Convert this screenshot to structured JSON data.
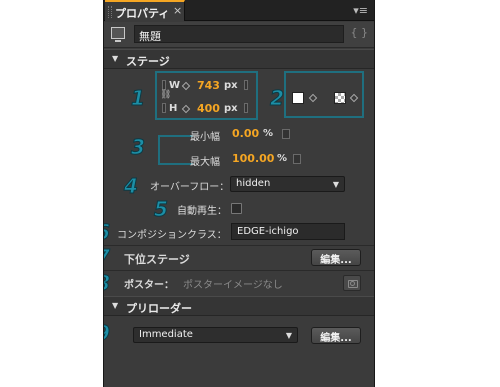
{
  "tab": {
    "title": "プロパティ",
    "close": "×",
    "menu_icon": "panel-menu-icon"
  },
  "document": {
    "name": "無題",
    "code_icon": "{ }"
  },
  "sections": {
    "stage": "ステージ",
    "preloader": "プリローダー"
  },
  "stage": {
    "w_label": "W",
    "h_label": "H",
    "width": "743",
    "height": "400",
    "unit": "px",
    "bg_color": "#ffffff",
    "min_label": "最小幅",
    "min_value": "0.00",
    "min_unit": "%",
    "max_label": "最大幅",
    "max_value": "100.00",
    "max_unit": "%",
    "overflow_label": "オーバーフロー：",
    "overflow_value": "hidden",
    "autoplay_label": "自動再生：",
    "autoplay_checked": false,
    "class_label": "コンポジションクラス：",
    "class_value": "EDGE-ichigo",
    "substage_label": "下位ステージ",
    "substage_button": "編集...",
    "poster_label": "ポスター：",
    "poster_placeholder": "ポスターイメージなし"
  },
  "preloader": {
    "value": "Immediate",
    "button": "編集..."
  },
  "annotations": [
    "1",
    "2",
    "3",
    "4",
    "5",
    "6",
    "7",
    "8",
    "9"
  ],
  "colors": {
    "accent": "#f5a623",
    "annotation": "#1c8ea6",
    "panel_bg": "#3b3b3b"
  }
}
